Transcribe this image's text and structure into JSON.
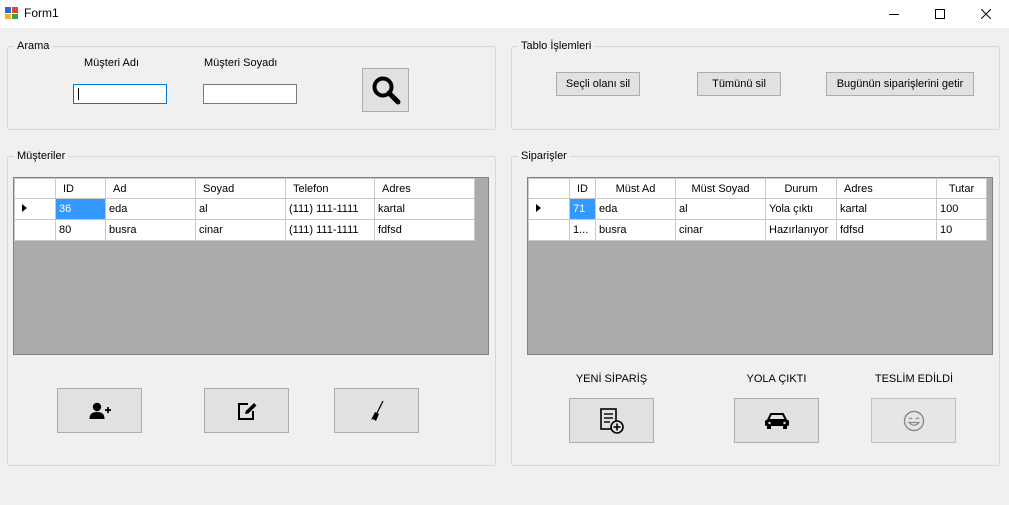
{
  "window": {
    "title": "Form1"
  },
  "search": {
    "title": "Arama",
    "first_name_label": "Müşteri Adı",
    "last_name_label": "Müşteri Soyadı",
    "first_name_value": "",
    "last_name_value": ""
  },
  "table_ops": {
    "title": "Tablo İşlemleri",
    "delete_selected": "Seçli olanı sil",
    "delete_all": "Tümünü sil",
    "get_today_orders": "Bugünün siparişlerini getir"
  },
  "customers": {
    "title": "Müşteriler",
    "columns": [
      "ID",
      "Ad",
      "Soyad",
      "Telefon",
      "Adres"
    ],
    "rows": [
      [
        "36",
        "eda",
        "al",
        "(111) 111-1111",
        "kartal"
      ],
      [
        "80",
        "busra",
        "cinar",
        "(111) 111-1111",
        "fdfsd"
      ]
    ]
  },
  "orders": {
    "title": "Siparişler",
    "columns": [
      "ID",
      "Müst Ad",
      "Müst Soyad",
      "Durum",
      "Adres",
      "Tutar"
    ],
    "rows": [
      [
        "71",
        "eda",
        "al",
        "Yola çıktı",
        "kartal",
        "100"
      ],
      [
        "1...",
        "busra",
        "cinar",
        "Hazırlanıyor",
        "fdfsd",
        "10"
      ]
    ],
    "new_order_label": "YENİ SİPARİŞ",
    "on_the_way_label": "YOLA ÇIKTI",
    "delivered_label": "TESLİM EDİLDİ"
  },
  "icons": {
    "search": "search-icon",
    "add_user": "add-user-icon",
    "edit": "edit-icon",
    "clear": "broom-icon",
    "new_order": "new-order-icon",
    "car": "car-icon",
    "smile": "smile-icon"
  }
}
